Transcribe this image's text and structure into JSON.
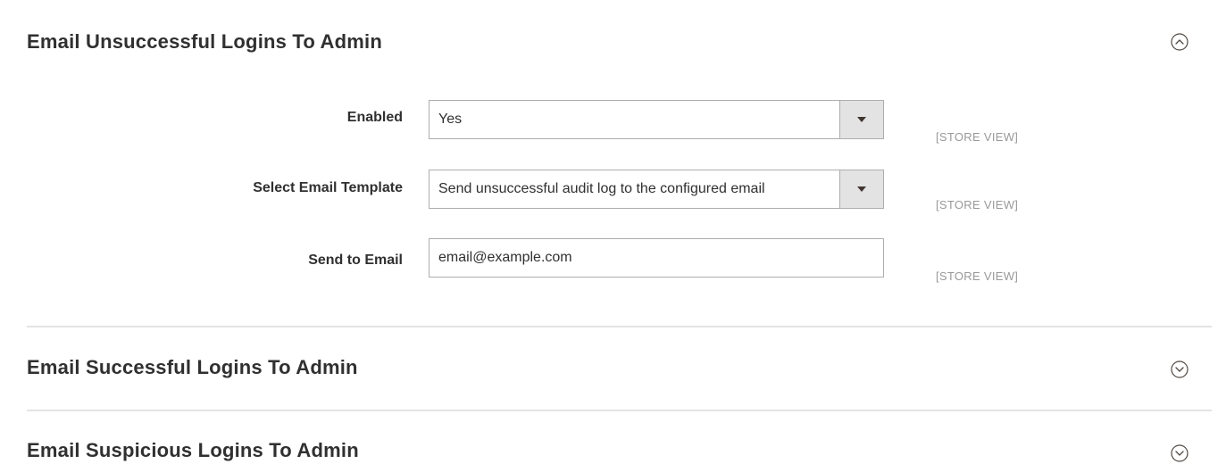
{
  "sections": [
    {
      "title": "Email Unsuccessful Logins To Admin",
      "expanded": true,
      "toggle_icon": "chevron-up-circle-icon",
      "fields": [
        {
          "label": "Enabled",
          "type": "select",
          "value": "Yes",
          "scope": "[STORE VIEW]"
        },
        {
          "label": "Select Email Template",
          "type": "select",
          "value": "Send unsuccessful audit log to the configured email",
          "scope": "[STORE VIEW]"
        },
        {
          "label": "Send to Email",
          "type": "text",
          "value": "email@example.com",
          "scope": "[STORE VIEW]"
        }
      ]
    },
    {
      "title": "Email Successful Logins To Admin",
      "expanded": false,
      "toggle_icon": "chevron-down-circle-icon"
    },
    {
      "title": "Email Suspicious Logins To Admin",
      "expanded": false,
      "toggle_icon": "chevron-down-circle-icon"
    }
  ],
  "colors": {
    "text": "#303030",
    "scope_text": "#999999",
    "border": "#adadad",
    "arrow_bg": "#e3e3e3",
    "divider": "#e3e3e3"
  }
}
